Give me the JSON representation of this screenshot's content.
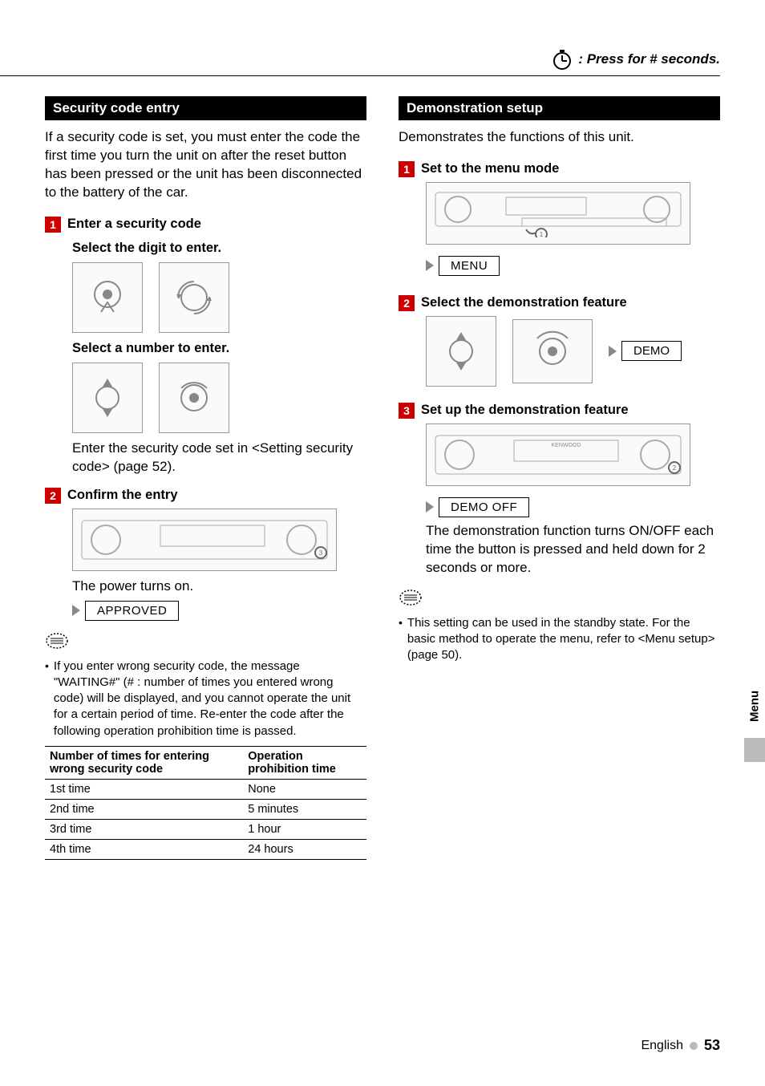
{
  "top_legend": ": Press for # seconds.",
  "left": {
    "section_title": "Security code entry",
    "intro": "If a security code is set, you must enter the code the first time you turn the unit on after the reset button has been pressed or the unit has been disconnected to the battery of the car.",
    "step1": {
      "num": "1",
      "title": "Enter a security code",
      "sub_a": "Select the digit to enter.",
      "sub_b": "Select a number to enter.",
      "body": "Enter the security code set in <Setting security code> (page 52)."
    },
    "step2": {
      "num": "2",
      "title": "Confirm the entry",
      "body": "The power turns on.",
      "display": "APPROVED"
    },
    "note_text": "If you enter wrong security code, the message \"WAITING#\" (# : number of times you entered wrong code) will be displayed, and you cannot operate the unit for a certain period of time. Re-enter the code after the following operation prohibition time is passed.",
    "table": {
      "col1_header": "Number of times for entering wrong security code",
      "col2_header": "Operation prohibition time",
      "rows": [
        {
          "attempt": "1st time",
          "time": "None"
        },
        {
          "attempt": "2nd time",
          "time": "5 minutes"
        },
        {
          "attempt": "3rd time",
          "time": "1 hour"
        },
        {
          "attempt": "4th time",
          "time": "24 hours"
        }
      ]
    }
  },
  "right": {
    "section_title": "Demonstration setup",
    "intro": "Demonstrates the functions of this unit.",
    "step1": {
      "num": "1",
      "title": "Set to the menu mode",
      "display": "MENU"
    },
    "step2": {
      "num": "2",
      "title": "Select the demonstration feature",
      "display": "DEMO"
    },
    "step3": {
      "num": "3",
      "title": "Set up the demonstration  feature",
      "display": "DEMO OFF",
      "body": "The demonstration function turns ON/OFF each time the button is pressed and held down for 2 seconds or more."
    },
    "note_text": "This setting can be used in the standby state. For the basic  method to operate the menu, refer to <Menu setup> (page 50)."
  },
  "side_tab": "Menu",
  "footer": {
    "lang": "English",
    "page": "53"
  }
}
